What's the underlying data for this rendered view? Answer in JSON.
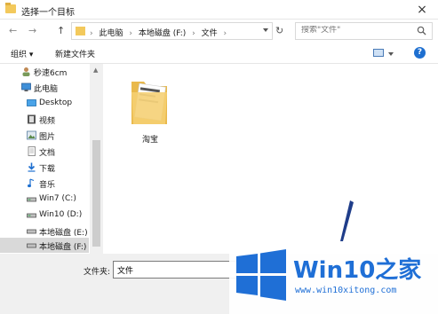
{
  "window": {
    "title": "选择一个目标",
    "close_glyph": "×"
  },
  "nav": {
    "back_glyph": "←",
    "forward_glyph": "→",
    "up_glyph": "↑",
    "breadcrumb": [
      "此电脑",
      "本地磁盘 (F:)",
      "文件"
    ],
    "separator": "›",
    "refresh_glyph": "↻",
    "search_placeholder": "搜索\"文件\""
  },
  "toolbar": {
    "organize_label": "组织 ▾",
    "new_folder_label": "新建文件夹",
    "help_glyph": "?"
  },
  "sidebar": {
    "items": [
      {
        "label": "秒速6cm",
        "icon": "user-icon"
      },
      {
        "label": "此电脑",
        "icon": "computer-icon"
      },
      {
        "label": "Desktop",
        "icon": "desktop-icon"
      },
      {
        "label": "视频",
        "icon": "video-icon"
      },
      {
        "label": "图片",
        "icon": "picture-icon"
      },
      {
        "label": "文档",
        "icon": "document-icon"
      },
      {
        "label": "下载",
        "icon": "download-icon"
      },
      {
        "label": "音乐",
        "icon": "music-icon"
      },
      {
        "label": "Win7 (C:)",
        "icon": "drive-icon"
      },
      {
        "label": "Win10 (D:)",
        "icon": "drive-icon"
      },
      {
        "label": "本地磁盘 (E:)",
        "icon": "drive-icon"
      },
      {
        "label": "本地磁盘 (F:)",
        "icon": "drive-icon",
        "selected": true
      }
    ]
  },
  "content": {
    "items": [
      {
        "label": "淘宝",
        "icon": "folder-icon"
      }
    ]
  },
  "bottom": {
    "filename_label": "文件夹:",
    "filename_value": "文件"
  },
  "watermark": {
    "title_a": "Win10",
    "title_b": "之家",
    "url": "www.win10xitong.com"
  },
  "colors": {
    "accent": "#1f6fd6",
    "folder": "#f3c95c",
    "selected": "#d9d9d9"
  }
}
